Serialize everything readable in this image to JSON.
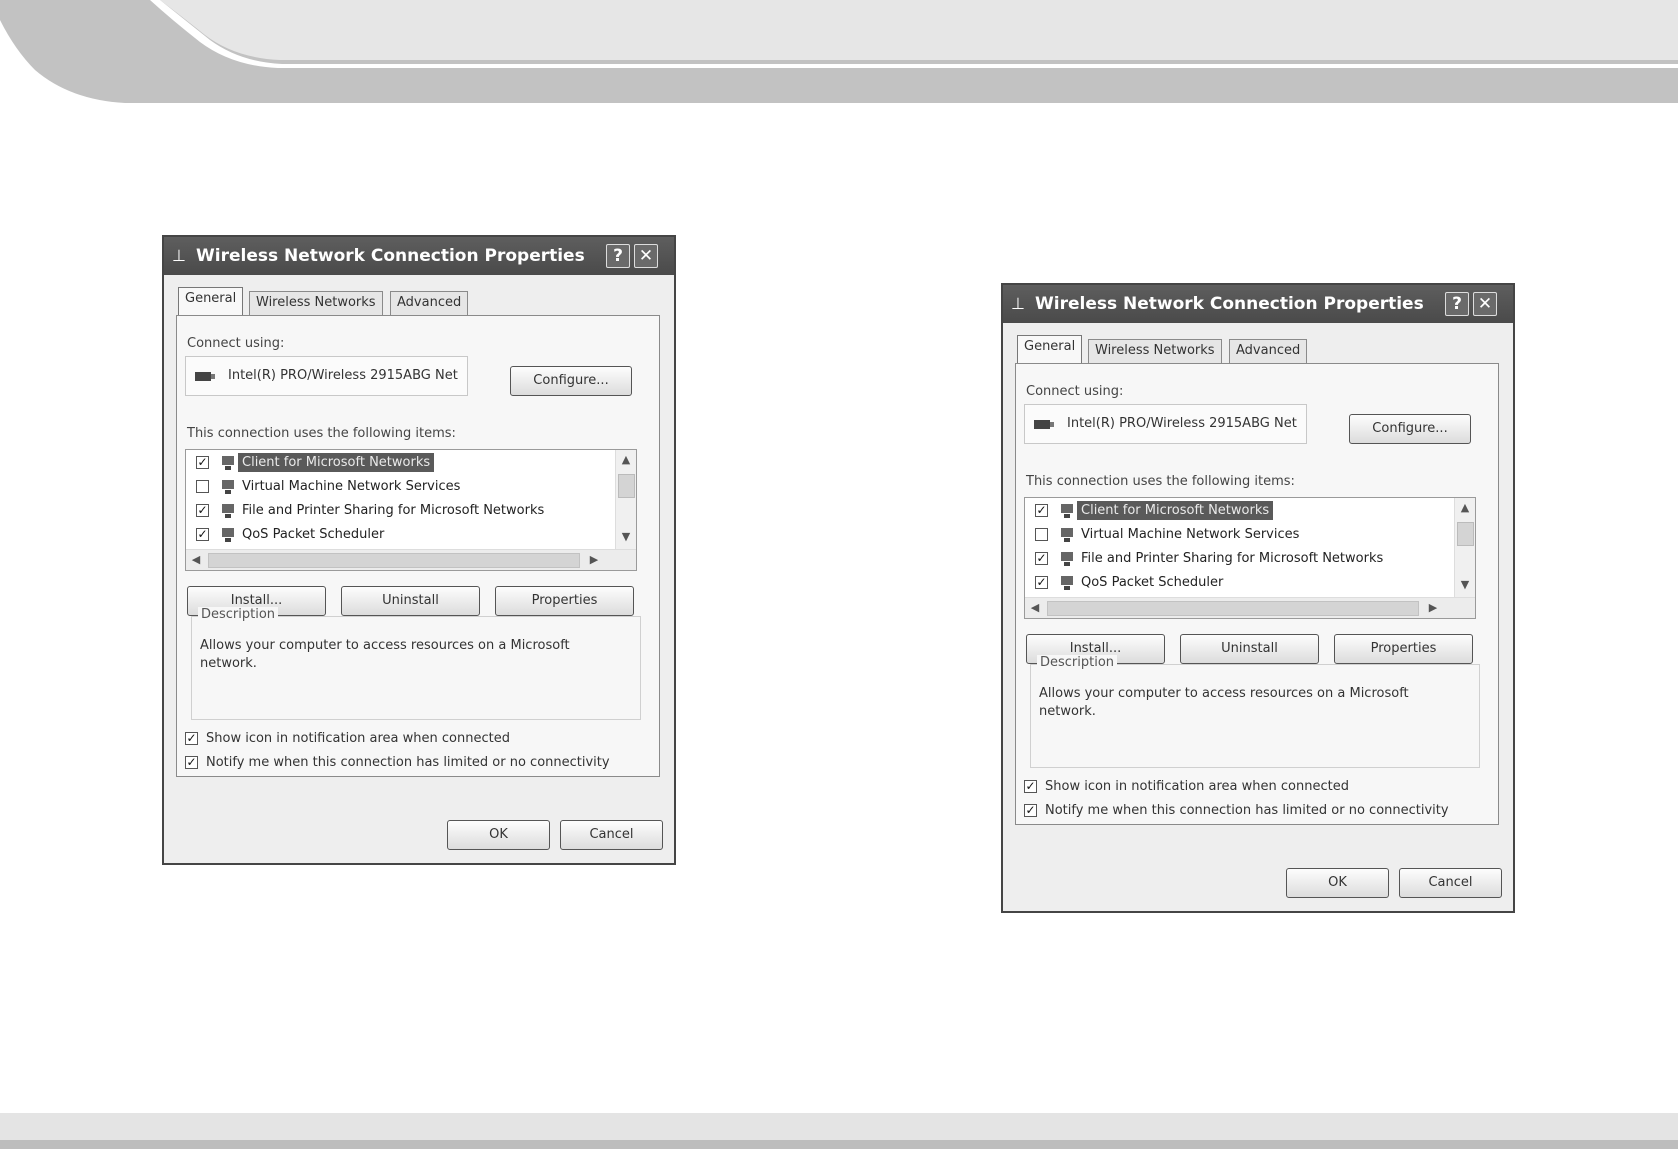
{
  "dialogs": [
    {
      "title": "Wireless Network Connection Properties",
      "help_button": "?",
      "close_button": "✕",
      "tabs": [
        "General",
        "Wireless Networks",
        "Advanced"
      ],
      "connect_using_label": "Connect using:",
      "adapter_name": "Intel(R) PRO/Wireless 2915ABG Net",
      "configure_button": "Configure...",
      "items_label": "This connection uses the following items:",
      "items": [
        {
          "label": "Client for Microsoft Networks",
          "checked": true,
          "selected": true
        },
        {
          "label": "Virtual Machine Network Services",
          "checked": false,
          "selected": false
        },
        {
          "label": "File and Printer Sharing for Microsoft Networks",
          "checked": true,
          "selected": false
        },
        {
          "label": "QoS Packet Scheduler",
          "checked": true,
          "selected": false
        }
      ],
      "install_button": "Install...",
      "uninstall_button": "Uninstall",
      "properties_button": "Properties",
      "description_legend": "Description",
      "description_text": "Allows your computer to access resources on a Microsoft network.",
      "show_icon_option": "Show icon in notification area when connected",
      "notify_option": "Notify me when this connection has limited or no connectivity",
      "ok_button": "OK",
      "cancel_button": "Cancel"
    },
    {
      "title": "Wireless Network Connection Properties",
      "help_button": "?",
      "close_button": "✕",
      "tabs": [
        "General",
        "Wireless Networks",
        "Advanced"
      ],
      "connect_using_label": "Connect using:",
      "adapter_name": "Intel(R) PRO/Wireless 2915ABG Net",
      "configure_button": "Configure...",
      "items_label": "This connection uses the following items:",
      "items": [
        {
          "label": "Client for Microsoft Networks",
          "checked": true,
          "selected": true
        },
        {
          "label": "Virtual Machine Network Services",
          "checked": false,
          "selected": false
        },
        {
          "label": "File and Printer Sharing for Microsoft Networks",
          "checked": true,
          "selected": false
        },
        {
          "label": "QoS Packet Scheduler",
          "checked": true,
          "selected": false
        }
      ],
      "install_button": "Install...",
      "uninstall_button": "Uninstall",
      "properties_button": "Properties",
      "description_legend": "Description",
      "description_text": "Allows your computer to access resources on a Microsoft network.",
      "show_icon_option": "Show icon in notification area when connected",
      "notify_option": "Notify me when this connection has limited or no connectivity",
      "ok_button": "OK",
      "cancel_button": "Cancel"
    }
  ]
}
